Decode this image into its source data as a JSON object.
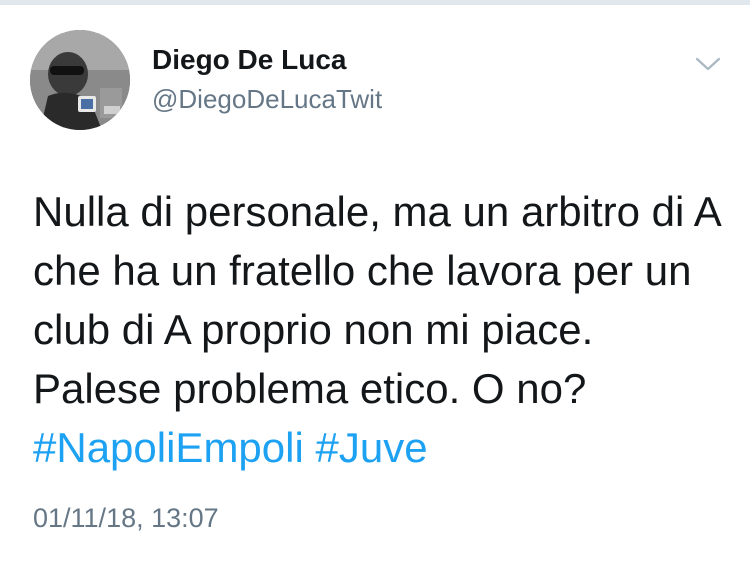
{
  "author": {
    "display_name": "Diego De Luca",
    "handle": "@DiegoDeLucaTwit"
  },
  "tweet": {
    "lines": [
      "Nulla di personale, ma un arbitro di A",
      "che ha un fratello che lavora per un",
      "club di A proprio non mi piace.",
      "Palese problema etico. O no?"
    ],
    "hashtags": [
      "#NapoliEmpoli",
      "#Juve"
    ],
    "timestamp": "01/11/18, 13:07"
  },
  "icons": {
    "menu": "chevron-down-icon"
  },
  "colors": {
    "link": "#1da1f2",
    "secondary_text": "#657786",
    "primary_text": "#14171a"
  }
}
